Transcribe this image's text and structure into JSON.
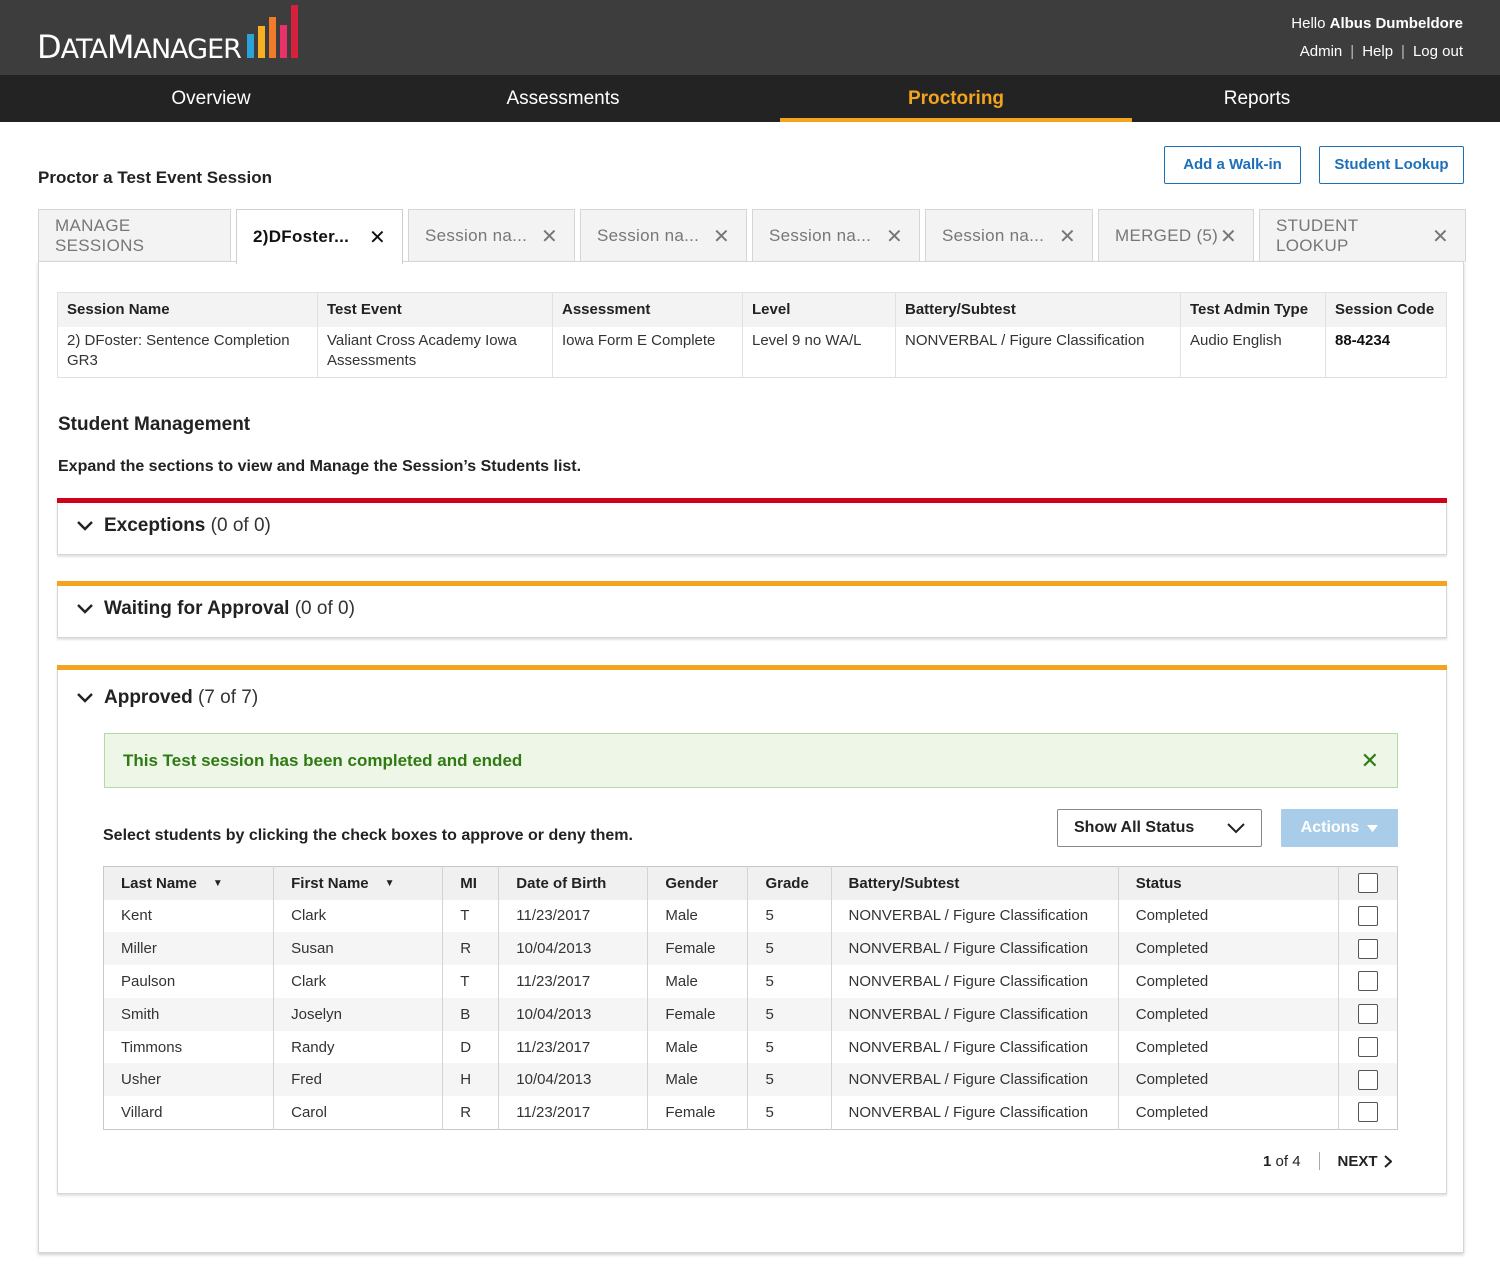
{
  "app": {
    "logo_text_prefix": "D",
    "logo_text_rest1": "ATA",
    "logo_text_m": "M",
    "logo_text_rest2": "ANAGER",
    "greeting_prefix": "Hello",
    "user_name": "Albus Dumbeldore",
    "links": [
      "Admin",
      "Help",
      "Log out"
    ]
  },
  "nav": {
    "items": [
      "Overview",
      "Assessments",
      "Proctoring",
      "Reports"
    ],
    "active": "Proctoring",
    "accent_color": "#f2a31f"
  },
  "page": {
    "title": "Proctor a Test Event Session",
    "add_walkin": "Add a Walk-in",
    "student_lookup": "Student Lookup"
  },
  "tabs": [
    {
      "label": "MANAGE SESSIONS",
      "closable": false
    },
    {
      "label": "2)DFoster...",
      "closable": true,
      "active": true
    },
    {
      "label": "Session na...",
      "closable": true
    },
    {
      "label": "Session na...",
      "closable": true
    },
    {
      "label": "Session na...",
      "closable": true
    },
    {
      "label": "Session na...",
      "closable": true
    },
    {
      "label": "MERGED (5)",
      "closable": true
    },
    {
      "label": "STUDENT LOOKUP",
      "closable": true
    }
  ],
  "session_info": {
    "headers": [
      "Session Name",
      "Test Event",
      "Assessment",
      "Level",
      "Battery/Subtest",
      "Test Admin Type",
      "Session Code"
    ],
    "values": [
      "2) DFoster: Sentence Completion GR3",
      "Valiant Cross Academy Iowa Assessments",
      "Iowa Form E Complete",
      "Level 9 no WA/L",
      "NONVERBAL / Figure Classification",
      "Audio English",
      "88-4234"
    ]
  },
  "student_management": {
    "title": "Student Management",
    "description": "Expand the sections to view and Manage the Session’s Students list."
  },
  "sections": {
    "exceptions": {
      "label": "Exceptions",
      "count": "(0 of 0)",
      "color": "#d0021b"
    },
    "waiting": {
      "label": "Waiting for Approval",
      "count": "(0 of 0)",
      "color": "#f2a31f"
    },
    "approved": {
      "label": "Approved",
      "count": "(7 of 7)",
      "color": "#f2a31f"
    }
  },
  "approved": {
    "alert": "This Test session has been completed and ended",
    "instruction": "Select students by clicking the check boxes to approve or deny them.",
    "status_filter": "Show All Status",
    "actions": "Actions",
    "columns": [
      "Last Name",
      "First Name",
      "MI",
      "Date of Birth",
      "Gender",
      "Grade",
      "Battery/Subtest",
      "Status"
    ],
    "rows": [
      [
        "Kent",
        "Clark",
        "T",
        "11/23/2017",
        "Male",
        "5",
        "NONVERBAL / Figure Classification",
        "Completed"
      ],
      [
        "Miller",
        "Susan",
        "R",
        "10/04/2013",
        "Female",
        "5",
        "NONVERBAL / Figure Classification",
        "Completed"
      ],
      [
        "Paulson",
        "Clark",
        "T",
        "11/23/2017",
        "Male",
        "5",
        "NONVERBAL / Figure Classification",
        "Completed"
      ],
      [
        "Smith",
        "Joselyn",
        "B",
        "10/04/2013",
        "Female",
        "5",
        "NONVERBAL / Figure Classification",
        "Completed"
      ],
      [
        "Timmons",
        "Randy",
        "D",
        "11/23/2017",
        "Male",
        "5",
        "NONVERBAL / Figure Classification",
        "Completed"
      ],
      [
        "Usher",
        "Fred",
        "H",
        "10/04/2013",
        "Male",
        "5",
        "NONVERBAL / Figure Classification",
        "Completed"
      ],
      [
        "Villard",
        "Carol",
        "R",
        "11/23/2017",
        "Female",
        "5",
        "NONVERBAL / Figure Classification",
        "Completed"
      ]
    ],
    "pager": {
      "current": "1",
      "of_text": "of 4",
      "next": "NEXT"
    }
  }
}
